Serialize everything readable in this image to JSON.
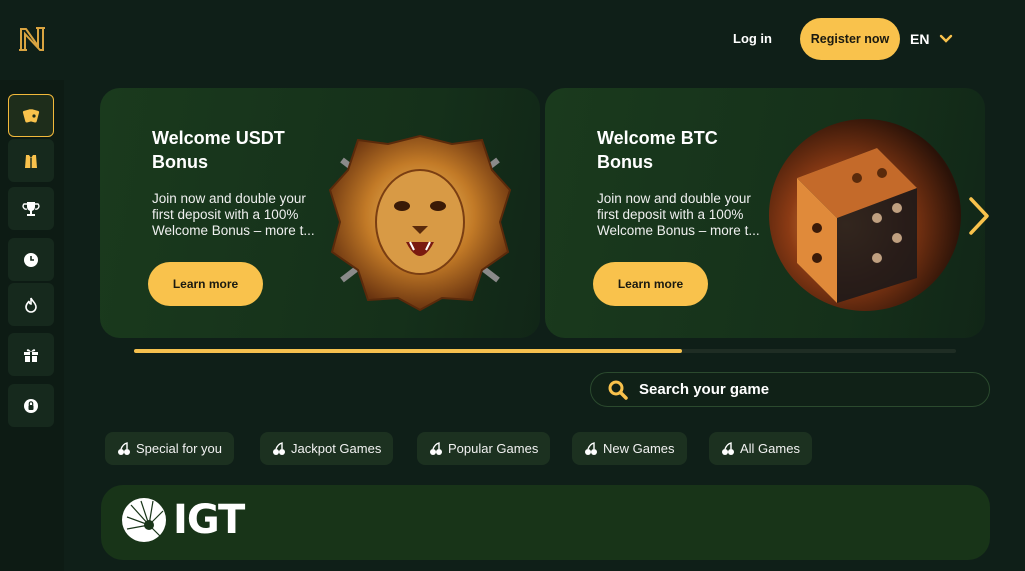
{
  "header": {
    "logo_icon": "N-monogram-logo",
    "login_label": "Log in",
    "register_label": "Register now",
    "language": "EN"
  },
  "sidebar": {
    "items": [
      {
        "icon": "cards-icon",
        "active": true
      },
      {
        "icon": "vest-icon",
        "active": false
      },
      {
        "icon": "trophy-icon",
        "active": false
      },
      {
        "icon": "clock-icon",
        "active": false
      },
      {
        "icon": "flame-icon",
        "active": false
      },
      {
        "icon": "gift-icon",
        "active": false
      },
      {
        "icon": "lock-badge-icon",
        "active": false
      }
    ]
  },
  "promotions": [
    {
      "title": "Welcome USDT Bonus",
      "description": "Join now and double your first deposit with a 100% Welcome Bonus – more t...",
      "button_label": "Learn more",
      "image": "golden-lion-emblem"
    },
    {
      "title": "Welcome BTC Bonus",
      "description": "Join now and double your first deposit with a 100% Welcome Bonus – more t...",
      "button_label": "Learn more",
      "image": "golden-dice"
    }
  ],
  "carousel": {
    "progress_fraction": 0.667
  },
  "search": {
    "placeholder": "Search your game"
  },
  "categories": [
    "Special for you",
    "Jackpot Games",
    "Popular Games",
    "New Games",
    "All Games"
  ],
  "provider": {
    "name": "IGT"
  },
  "colors": {
    "accent": "#f9c24c",
    "background": "#0f1f18",
    "card": "#183418",
    "chip": "#1c3120"
  }
}
